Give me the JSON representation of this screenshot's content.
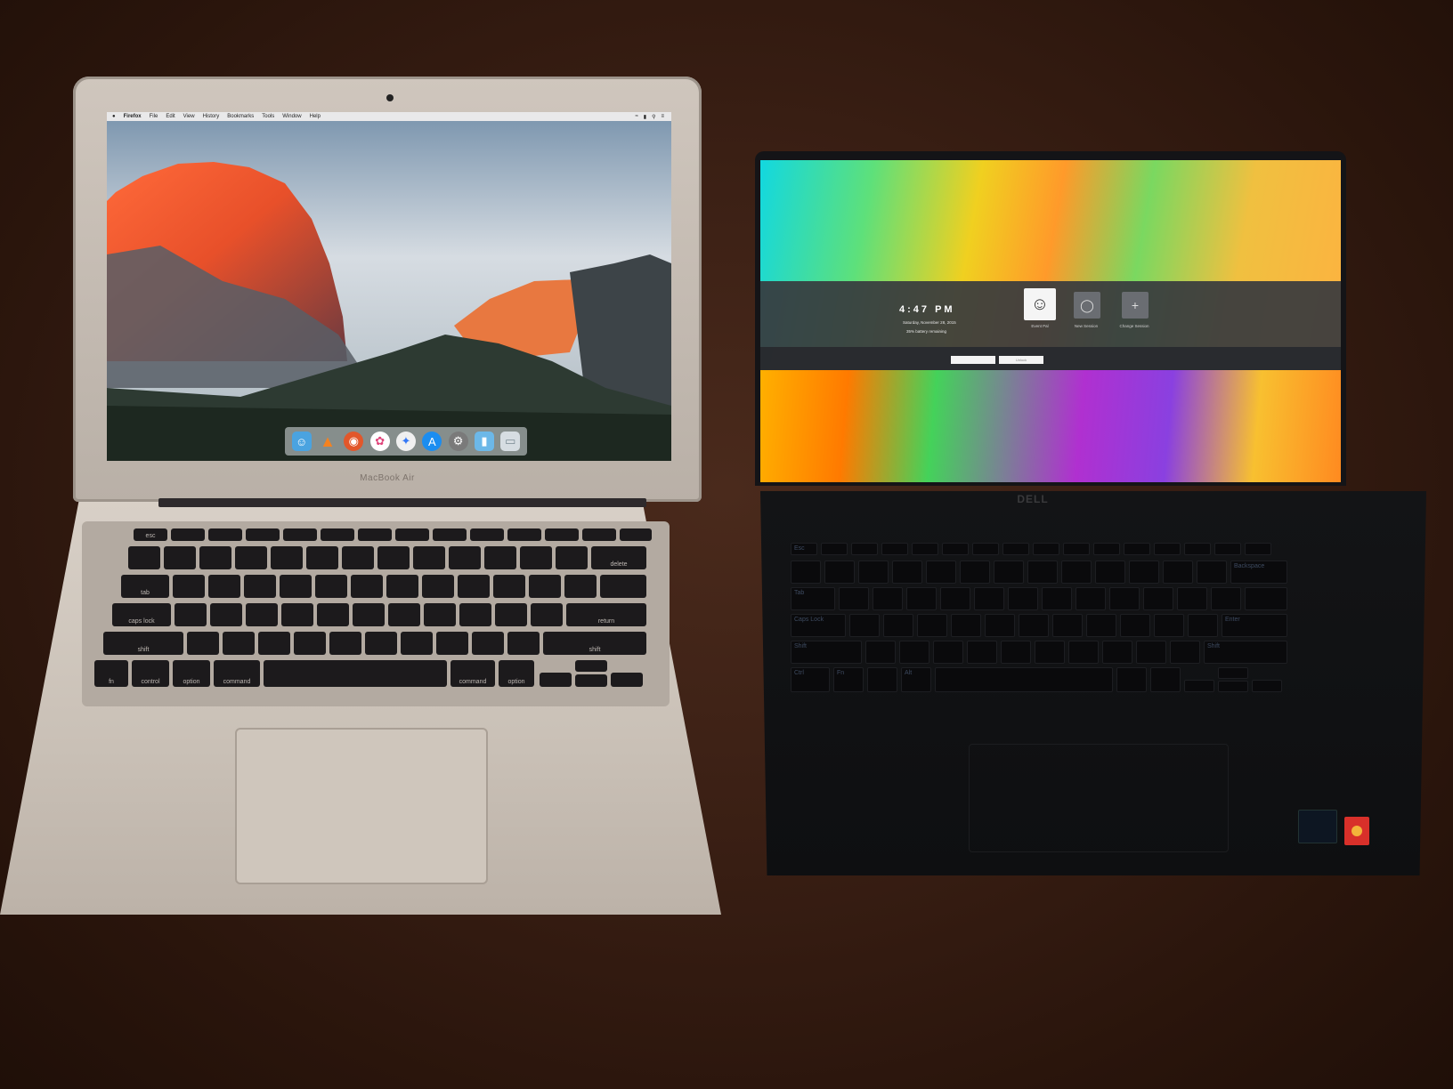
{
  "macbook": {
    "brand_label": "MacBook Air",
    "menubar": {
      "apple": "",
      "items": [
        "Firefox",
        "File",
        "Edit",
        "View",
        "History",
        "Bookmarks",
        "Tools",
        "Window",
        "Help"
      ]
    },
    "dock_icons": [
      "finder-icon",
      "vlc-icon",
      "firefox-icon",
      "photos-icon",
      "safari-icon",
      "app-store-icon",
      "system-preferences-icon",
      "folder-icon",
      "trash-icon"
    ],
    "keyboard_labels": {
      "esc": "esc",
      "delete": "delete",
      "tab": "tab",
      "caps": "caps lock",
      "return": "return",
      "shift_l": "shift",
      "shift_r": "shift",
      "fn": "fn",
      "control": "control",
      "option_l": "option",
      "command_l": "command",
      "command_r": "command",
      "option_r": "option"
    }
  },
  "dell": {
    "brand_label": "DELL",
    "lock_screen": {
      "time": "4:47 PM",
      "date": "Saturday, November 28, 2015",
      "battery": "35% battery remaining",
      "users": [
        {
          "label": "Event Pal",
          "icon": "user-icon"
        },
        {
          "label": "New Session",
          "icon": "session-icon"
        },
        {
          "label": "Change Session",
          "icon": "add-user-icon"
        }
      ],
      "fields": [
        "",
        "Unlock"
      ]
    },
    "keyboard_labels": {
      "esc": "Esc",
      "backspace": "Backspace",
      "tab": "Tab",
      "caps": "Caps Lock",
      "enter": "Enter",
      "shift_l": "Shift",
      "shift_r": "Shift",
      "ctrl": "Ctrl",
      "fn": "Fn",
      "alt": "Alt"
    }
  },
  "colors": {
    "mac_aluminium": "#c9c0b6",
    "dell_black": "#131416",
    "table_wood": "#3a1f14"
  }
}
